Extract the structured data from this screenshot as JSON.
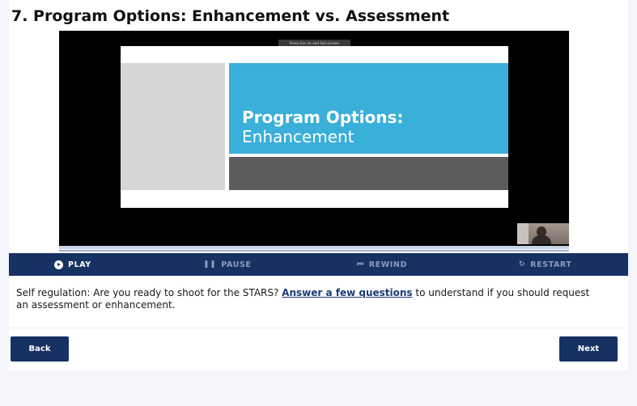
{
  "page": {
    "title": "7. Program Options: Enhancement vs. Assessment"
  },
  "video": {
    "fullscreen_hint": "Press Esc to exit full screen",
    "slide": {
      "heading": "Program Options:",
      "subheading": "Enhancement"
    }
  },
  "controls": {
    "play": "PLAY",
    "pause": "PAUSE",
    "rewind": "REWIND",
    "restart": "RESTART"
  },
  "description": {
    "before_link": "Self regulation: Are you ready to shoot for the STARS? ",
    "link": "Answer a few questions",
    "after_link": " to understand if you should request an assessment or enhancement."
  },
  "nav": {
    "back": "Back",
    "next": "Next"
  },
  "colors": {
    "accent": "#163263",
    "slide_blue": "#3aafd9",
    "page_bg": "#f3f5fa"
  }
}
